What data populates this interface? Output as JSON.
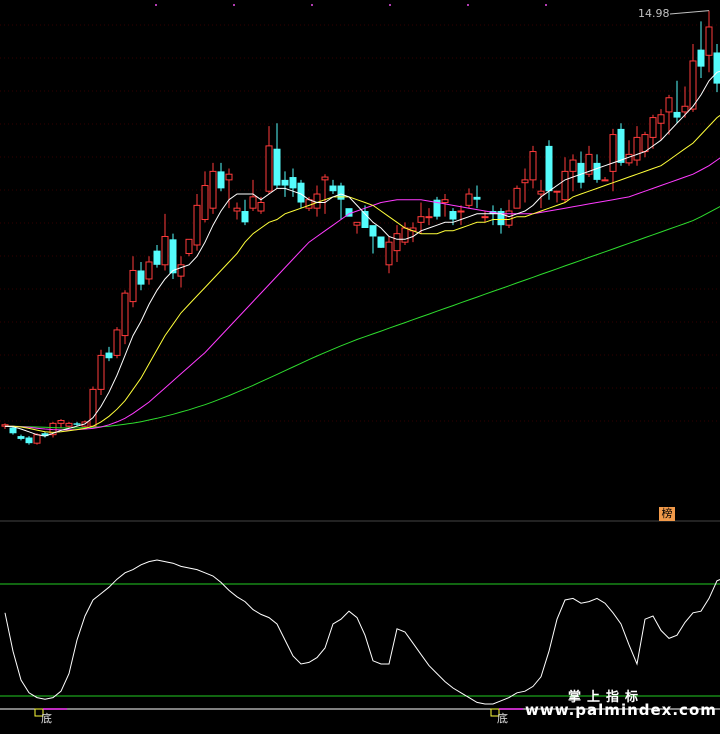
{
  "chart_data": {
    "type": "candlestick",
    "price_panel": {
      "peak_label": "14.98",
      "colors": {
        "up": "#ff3b3b",
        "down": "#54fcfc",
        "ma5": "#ffffff",
        "ma10": "#ffff3a",
        "ma20": "#ff3bff",
        "ma60": "#2edc2e"
      },
      "candles": [
        [
          0.3,
          0.35,
          0.2,
          0.4
        ],
        [
          0.25,
          0.05,
          0.0,
          0.3
        ],
        [
          -0.05,
          -0.15,
          -0.2,
          0.0
        ],
        [
          -0.1,
          -0.3,
          -0.35,
          -0.05
        ],
        [
          -0.3,
          0.0,
          -0.35,
          0.05
        ],
        [
          0.05,
          -0.05,
          -0.1,
          0.1
        ],
        [
          0.0,
          0.4,
          -0.1,
          0.45
        ],
        [
          0.4,
          0.5,
          0.25,
          0.55
        ],
        [
          0.3,
          0.4,
          0.25,
          0.45
        ],
        [
          0.4,
          0.35,
          0.3,
          0.45
        ],
        [
          0.3,
          0.45,
          0.25,
          0.5
        ],
        [
          0.3,
          1.6,
          0.25,
          1.7
        ],
        [
          1.6,
          2.8,
          1.4,
          3.0
        ],
        [
          2.9,
          2.7,
          2.6,
          3.1
        ],
        [
          2.8,
          3.7,
          2.7,
          3.8
        ],
        [
          3.5,
          5.0,
          3.2,
          5.1
        ],
        [
          4.7,
          5.8,
          4.5,
          6.3
        ],
        [
          5.8,
          5.3,
          5.1,
          6.1
        ],
        [
          5.5,
          6.1,
          5.3,
          6.3
        ],
        [
          6.5,
          6.0,
          5.9,
          6.7
        ],
        [
          6.0,
          7.0,
          5.8,
          7.8
        ],
        [
          6.9,
          5.7,
          5.5,
          7.1
        ],
        [
          5.6,
          6.0,
          5.2,
          6.3
        ],
        [
          6.4,
          6.9,
          6.3,
          6.9
        ],
        [
          6.7,
          8.1,
          6.5,
          8.5
        ],
        [
          7.6,
          8.8,
          7.5,
          9.3
        ],
        [
          8.0,
          9.3,
          7.8,
          9.6
        ],
        [
          9.3,
          8.7,
          8.6,
          9.6
        ],
        [
          9.0,
          9.2,
          8.0,
          9.4
        ],
        [
          7.9,
          8.0,
          7.6,
          8.2
        ],
        [
          7.9,
          7.5,
          7.4,
          8.3
        ],
        [
          8.0,
          8.4,
          7.9,
          9.0
        ],
        [
          7.9,
          8.2,
          7.8,
          8.4
        ],
        [
          8.6,
          10.2,
          8.5,
          10.9
        ],
        [
          10.1,
          8.8,
          8.7,
          11.0
        ],
        [
          9.0,
          8.8,
          8.4,
          9.3
        ],
        [
          9.1,
          8.7,
          8.4,
          9.4
        ],
        [
          8.9,
          8.2,
          8.0,
          9.0
        ],
        [
          8.0,
          8.3,
          7.9,
          8.4
        ],
        [
          8.0,
          8.5,
          7.7,
          8.8
        ],
        [
          9.0,
          9.1,
          7.8,
          9.2
        ],
        [
          8.8,
          8.6,
          8.5,
          9.0
        ],
        [
          8.8,
          8.3,
          7.6,
          8.9
        ],
        [
          8.0,
          7.7,
          7.7,
          7.7
        ],
        [
          7.4,
          7.5,
          7.1,
          7.5
        ],
        [
          7.9,
          7.3,
          7.3,
          8.1
        ],
        [
          7.4,
          7.0,
          6.4,
          7.3
        ],
        [
          7.0,
          6.6,
          6.6,
          6.9
        ],
        [
          6.0,
          6.8,
          5.7,
          7.0
        ],
        [
          6.5,
          7.1,
          6.1,
          7.4
        ],
        [
          6.8,
          7.3,
          6.7,
          7.5
        ],
        [
          7.2,
          7.3,
          6.8,
          7.5
        ],
        [
          7.5,
          7.7,
          7.1,
          8.2
        ],
        [
          7.7,
          7.7,
          7.4,
          8.0
        ],
        [
          8.3,
          7.7,
          7.6,
          8.4
        ],
        [
          8.2,
          8.3,
          7.7,
          8.5
        ],
        [
          7.9,
          7.6,
          7.4,
          8.0
        ],
        [
          7.9,
          7.9,
          7.4,
          8.1
        ],
        [
          8.1,
          8.5,
          8.0,
          8.7
        ],
        [
          8.4,
          8.3,
          8.0,
          8.8
        ],
        [
          7.7,
          7.7,
          7.5,
          7.9
        ],
        [
          7.9,
          7.8,
          7.4,
          8.1
        ],
        [
          7.9,
          7.4,
          7.1,
          8.0
        ],
        [
          7.4,
          7.9,
          7.3,
          8.3
        ],
        [
          8.0,
          8.7,
          8.0,
          8.8
        ],
        [
          8.9,
          9.0,
          8.2,
          9.4
        ],
        [
          9.0,
          10.0,
          8.7,
          10.2
        ],
        [
          8.5,
          8.6,
          8.0,
          9.0
        ],
        [
          10.2,
          8.6,
          8.3,
          10.4
        ],
        [
          8.6,
          8.6,
          8.2,
          8.6
        ],
        [
          8.3,
          9.3,
          8.2,
          9.8
        ],
        [
          9.3,
          9.7,
          8.6,
          9.9
        ],
        [
          9.6,
          8.9,
          8.7,
          10.0
        ],
        [
          9.2,
          9.9,
          9.1,
          10.2
        ],
        [
          9.6,
          9.0,
          8.9,
          9.9
        ],
        [
          9.0,
          9.0,
          9.0,
          9.1
        ],
        [
          9.3,
          10.6,
          8.6,
          10.8
        ],
        [
          10.8,
          9.6,
          9.5,
          11.0
        ],
        [
          9.6,
          9.9,
          9.5,
          10.4
        ],
        [
          9.7,
          10.5,
          9.5,
          10.9
        ],
        [
          10.0,
          10.6,
          9.8,
          10.7
        ],
        [
          10.5,
          11.2,
          10.1,
          11.3
        ],
        [
          11.0,
          11.3,
          10.4,
          11.5
        ],
        [
          11.4,
          11.9,
          10.6,
          12.0
        ],
        [
          11.4,
          11.2,
          11.0,
          12.5
        ],
        [
          11.4,
          11.6,
          11.2,
          12.3
        ],
        [
          11.5,
          13.2,
          11.4,
          13.8
        ],
        [
          13.6,
          13.0,
          12.6,
          14.6
        ],
        [
          13.4,
          14.4,
          12.8,
          14.98
        ],
        [
          13.5,
          12.4,
          12.1,
          13.8
        ],
        [
          12.3,
          12.2,
          11.9,
          12.4
        ],
        [
          12.2,
          12.3,
          11.8,
          12.7
        ]
      ],
      "ma5": [
        0.3,
        0.28,
        0.2,
        0.1,
        0.0,
        -0.05,
        0.05,
        0.15,
        0.22,
        0.3,
        0.38,
        0.6,
        1.0,
        1.5,
        2.1,
        2.8,
        3.5,
        4.0,
        4.6,
        5.1,
        5.5,
        5.8,
        5.9,
        6.0,
        6.3,
        6.8,
        7.4,
        7.9,
        8.3,
        8.5,
        8.5,
        8.5,
        8.3,
        8.5,
        8.7,
        8.7,
        8.6,
        8.5,
        8.3,
        8.2,
        8.2,
        8.4,
        8.5,
        8.4,
        8.1,
        7.8,
        7.5,
        7.3,
        7.0,
        6.9,
        6.9,
        7.0,
        7.2,
        7.3,
        7.4,
        7.5,
        7.5,
        7.6,
        7.7,
        7.8,
        7.8,
        7.8,
        7.8,
        7.7,
        7.8,
        7.9,
        8.1,
        8.4,
        8.6,
        8.8,
        9.0,
        9.1,
        9.2,
        9.3,
        9.4,
        9.5,
        9.6,
        9.7,
        9.8,
        9.9,
        10.0,
        10.2,
        10.4,
        10.7,
        11.0,
        11.3,
        11.6,
        12.0,
        12.5,
        12.8,
        12.9,
        12.9
      ],
      "ma10": [
        0.3,
        0.3,
        0.27,
        0.22,
        0.16,
        0.1,
        0.08,
        0.1,
        0.14,
        0.18,
        0.22,
        0.3,
        0.45,
        0.65,
        0.9,
        1.2,
        1.6,
        2.0,
        2.5,
        3.0,
        3.5,
        3.9,
        4.3,
        4.6,
        4.9,
        5.2,
        5.5,
        5.8,
        6.1,
        6.4,
        6.8,
        7.1,
        7.3,
        7.5,
        7.6,
        7.8,
        7.9,
        8.0,
        8.1,
        8.2,
        8.3,
        8.4,
        8.4,
        8.4,
        8.3,
        8.2,
        8.1,
        7.9,
        7.7,
        7.5,
        7.3,
        7.2,
        7.1,
        7.1,
        7.1,
        7.2,
        7.2,
        7.3,
        7.4,
        7.5,
        7.5,
        7.6,
        7.6,
        7.6,
        7.7,
        7.7,
        7.8,
        7.9,
        8.0,
        8.1,
        8.2,
        8.4,
        8.5,
        8.6,
        8.7,
        8.8,
        8.9,
        9.0,
        9.1,
        9.2,
        9.3,
        9.4,
        9.5,
        9.7,
        9.9,
        10.1,
        10.3,
        10.6,
        10.9,
        11.2,
        11.4,
        11.6
      ],
      "ma20": [
        0.3,
        0.3,
        0.28,
        0.26,
        0.23,
        0.2,
        0.18,
        0.17,
        0.17,
        0.18,
        0.2,
        0.22,
        0.27,
        0.35,
        0.45,
        0.58,
        0.75,
        0.95,
        1.15,
        1.4,
        1.65,
        1.9,
        2.15,
        2.4,
        2.65,
        2.9,
        3.2,
        3.5,
        3.8,
        4.1,
        4.4,
        4.7,
        5.0,
        5.3,
        5.6,
        5.9,
        6.2,
        6.5,
        6.8,
        7.0,
        7.2,
        7.4,
        7.6,
        7.8,
        7.9,
        8.0,
        8.1,
        8.2,
        8.25,
        8.3,
        8.3,
        8.3,
        8.3,
        8.25,
        8.2,
        8.15,
        8.1,
        8.05,
        8.0,
        7.95,
        7.9,
        7.85,
        7.8,
        7.8,
        7.8,
        7.8,
        7.8,
        7.85,
        7.9,
        7.95,
        8.0,
        8.05,
        8.1,
        8.15,
        8.2,
        8.25,
        8.3,
        8.35,
        8.4,
        8.5,
        8.6,
        8.7,
        8.8,
        8.9,
        9.0,
        9.1,
        9.2,
        9.35,
        9.5,
        9.7,
        9.9,
        10.1
      ],
      "ma60": [
        0.3,
        0.3,
        0.29,
        0.28,
        0.27,
        0.26,
        0.25,
        0.24,
        0.24,
        0.24,
        0.25,
        0.26,
        0.28,
        0.3,
        0.33,
        0.37,
        0.41,
        0.46,
        0.52,
        0.58,
        0.65,
        0.72,
        0.8,
        0.88,
        0.97,
        1.06,
        1.16,
        1.27,
        1.38,
        1.5,
        1.62,
        1.74,
        1.87,
        2.0,
        2.13,
        2.26,
        2.39,
        2.52,
        2.65,
        2.78,
        2.9,
        3.02,
        3.14,
        3.25,
        3.36,
        3.46,
        3.56,
        3.66,
        3.76,
        3.86,
        3.96,
        4.06,
        4.16,
        4.26,
        4.36,
        4.46,
        4.56,
        4.66,
        4.76,
        4.86,
        4.96,
        5.06,
        5.16,
        5.26,
        5.36,
        5.46,
        5.56,
        5.66,
        5.76,
        5.86,
        5.96,
        6.06,
        6.16,
        6.26,
        6.36,
        6.46,
        6.56,
        6.66,
        6.76,
        6.86,
        6.96,
        7.06,
        7.16,
        7.26,
        7.36,
        7.46,
        7.56,
        7.7,
        7.85,
        8.0,
        8.15,
        8.3
      ]
    },
    "oscillator_panel": {
      "badge": "榜",
      "upper_level": 80,
      "lower_level": 10,
      "ylim": [
        0,
        100
      ],
      "values": [
        62,
        38,
        20,
        12,
        9,
        8,
        9,
        13,
        24,
        45,
        60,
        70,
        74,
        78,
        83,
        87,
        89,
        92,
        94,
        95,
        94,
        93,
        91,
        90,
        89,
        87,
        85,
        81,
        76,
        72,
        69,
        64,
        61,
        59,
        55,
        45,
        35,
        30,
        31,
        34,
        40,
        55,
        58,
        63,
        59,
        48,
        32,
        30,
        30,
        52,
        50,
        43,
        36,
        29,
        24,
        19,
        15,
        12,
        9,
        6,
        5,
        5,
        7,
        9,
        12,
        13,
        16,
        22,
        38,
        58,
        70,
        71,
        68,
        69,
        71,
        68,
        62,
        55,
        42,
        30,
        58,
        60,
        51,
        46,
        48,
        56,
        62,
        63,
        71,
        82,
        84,
        82,
        73,
        72
      ]
    },
    "signals": [
      {
        "label": "底",
        "position": 4
      },
      {
        "label": "底",
        "position": 61
      }
    ]
  },
  "watermark": {
    "title": "掌上指标",
    "url": "www.palmindex.com"
  }
}
